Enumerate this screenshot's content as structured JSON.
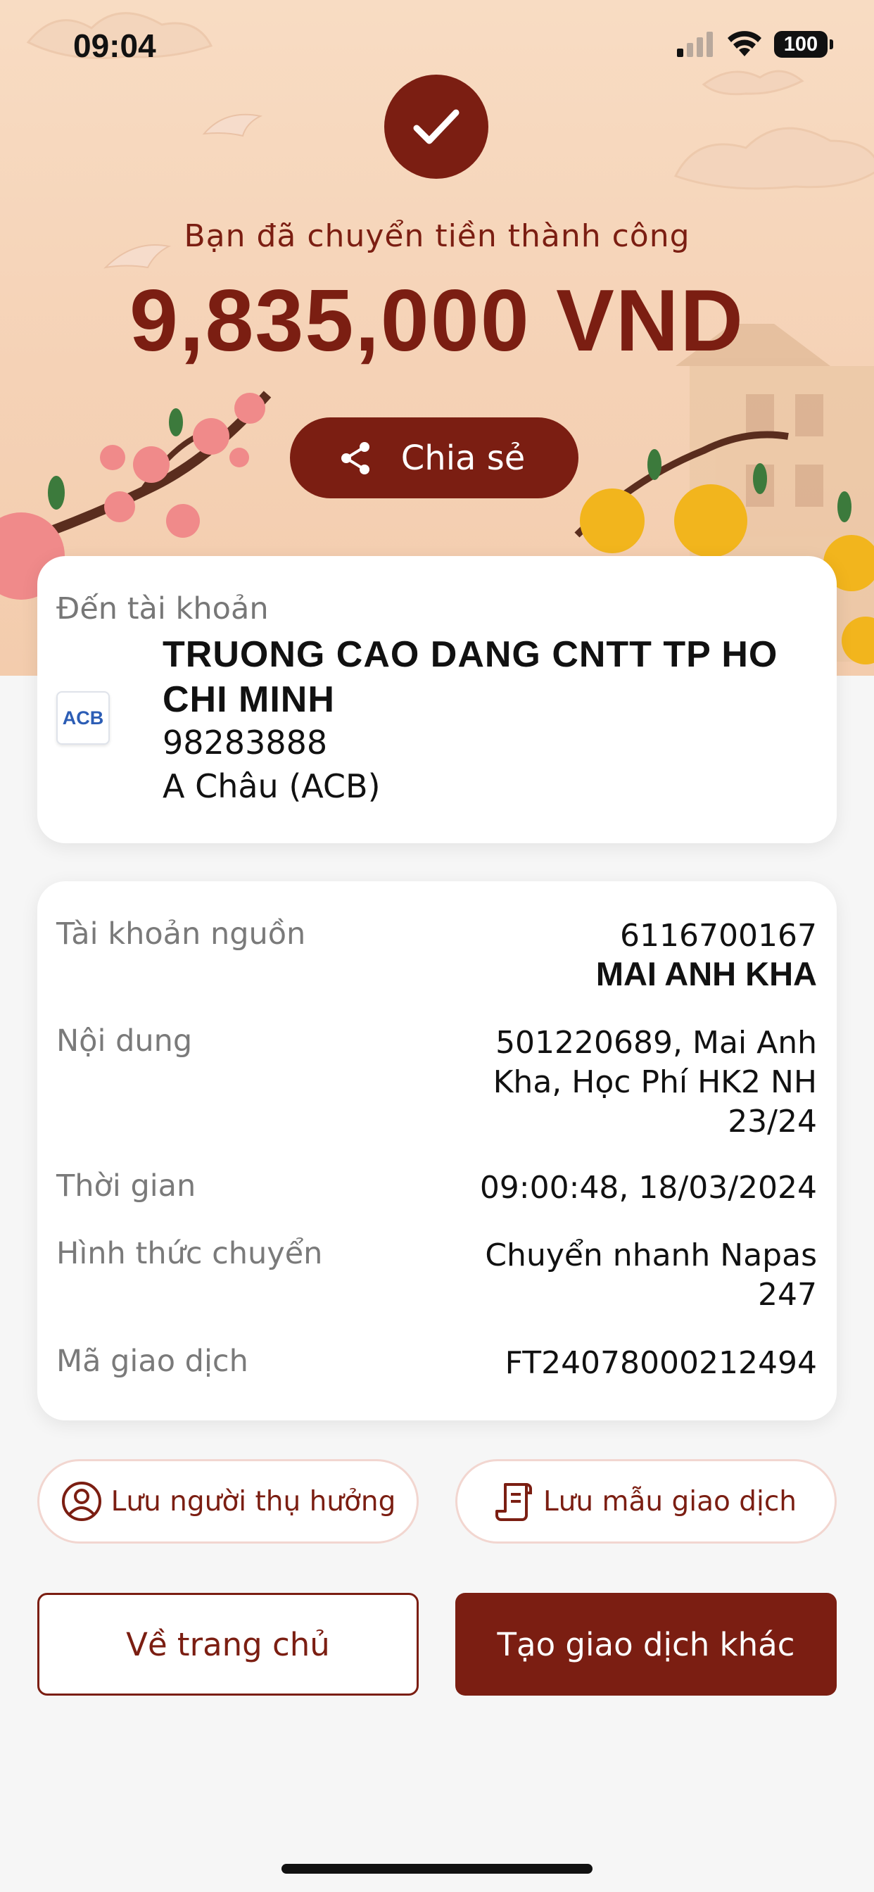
{
  "status_bar": {
    "time": "09:04",
    "battery": "100"
  },
  "success": {
    "title": "Bạn đã chuyển tiền thành công",
    "amount": "9,835,000 VND",
    "share_label": "Chia sẻ"
  },
  "destination": {
    "label": "Đến tài khoản",
    "bank_logo_text": "ACB",
    "name": "TRUONG CAO DANG CNTT TP HO CHI MINH",
    "account_number": "98283888",
    "bank_name": "A Châu (ACB)"
  },
  "details": {
    "source_label": "Tài khoản nguồn",
    "source_account": "6116700167",
    "source_name": "MAI ANH KHA",
    "content_label": "Nội dung",
    "content_line1": "501220689, Mai Anh",
    "content_line2": "Kha, Học Phí HK2 NH",
    "content_line3": "23/24",
    "time_label": "Thời gian",
    "time_value": "09:00:48, 18/03/2024",
    "method_label": "Hình thức chuyển",
    "method_line1": "Chuyển nhanh Napas",
    "method_line2": "247",
    "txn_label": "Mã giao dịch",
    "txn_value": "FT24078000212494"
  },
  "actions": {
    "save_beneficiary": "Lưu người thụ hưởng",
    "save_template": "Lưu mẫu giao dịch",
    "home": "Về trang chủ",
    "new_transaction": "Tạo giao dịch khác"
  },
  "colors": {
    "primary": "#7b1e12",
    "hero_bg": "#f5d2b6",
    "page_bg": "#f6f6f6"
  },
  "icons": [
    "signal-icon",
    "wifi-icon",
    "battery-icon",
    "checkmark-icon",
    "share-icon",
    "user-circle-icon",
    "document-icon"
  ]
}
